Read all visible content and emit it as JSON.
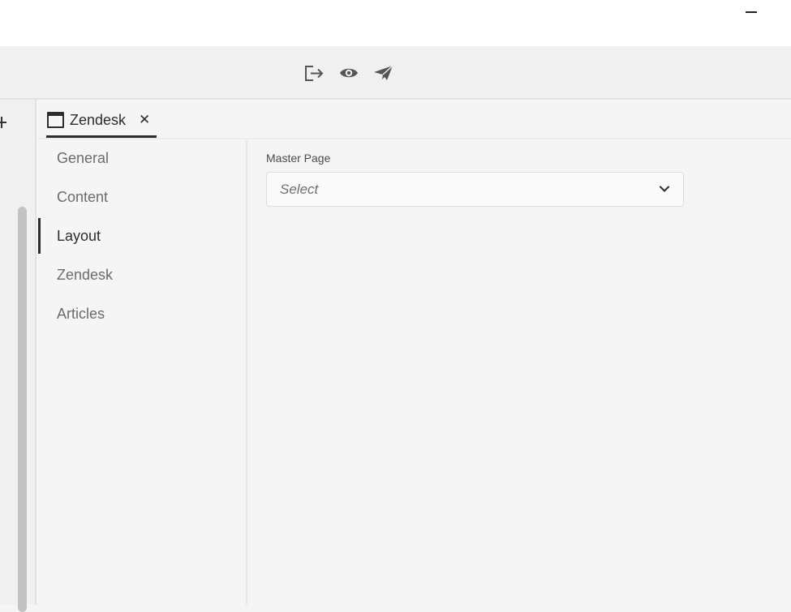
{
  "toolbar": {
    "icons": [
      "export-icon",
      "preview-eye-icon",
      "publish-send-icon"
    ]
  },
  "tab": {
    "label": "Zendesk",
    "close_glyph": "✕"
  },
  "sidenav": {
    "items": [
      {
        "label": "General",
        "active": false
      },
      {
        "label": "Content",
        "active": false
      },
      {
        "label": "Layout",
        "active": true
      },
      {
        "label": "Zendesk",
        "active": false
      },
      {
        "label": "Articles",
        "active": false
      }
    ]
  },
  "form": {
    "master_page_label": "Master Page",
    "master_page_placeholder": "Select"
  },
  "colors": {
    "accent": "#2c2c2c",
    "background": "#f5f5f5"
  }
}
